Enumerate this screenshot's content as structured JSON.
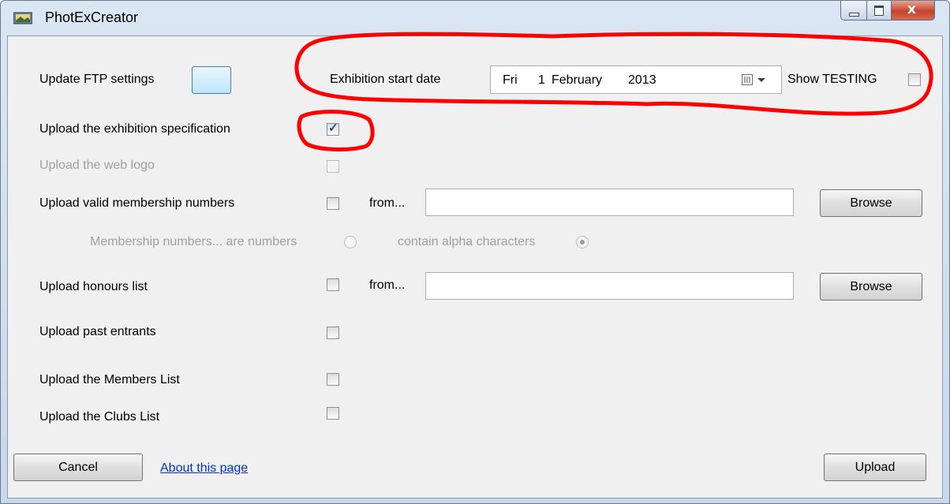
{
  "window": {
    "title": "PhotExCreator"
  },
  "ftp": {
    "label": "Update FTP settings",
    "button_label": ""
  },
  "exhibition": {
    "label": "Exhibition start date",
    "weekday": "Fri",
    "day": "1",
    "month": "February",
    "year": "2013"
  },
  "testing": {
    "label": "Show TESTING",
    "checked": false
  },
  "options": {
    "spec": {
      "label": "Upload the exhibition specification",
      "checked": true
    },
    "weblogo": {
      "label": "Upload the web logo",
      "checked": false,
      "disabled": true
    },
    "membership": {
      "label": "Upload valid membership numbers",
      "checked": false,
      "from_label": "from...",
      "path_value": "",
      "browse_label": "Browse"
    },
    "membership_type": {
      "label": "Membership numbers... are numbers",
      "alpha_label": "contain alpha characters",
      "selected": "contain alpha characters"
    },
    "honours": {
      "label": "Upload honours list",
      "checked": false,
      "from_label": "from...",
      "path_value": "",
      "browse_label": "Browse"
    },
    "past_entrants": {
      "label": "Upload past entrants",
      "checked": false
    },
    "members_list": {
      "label": "Upload the Members List",
      "checked": false
    },
    "clubs_list": {
      "label": "Upload the Clubs List",
      "checked": false
    }
  },
  "footer": {
    "cancel_label": "Cancel",
    "about_label": "About this page",
    "upload_label": "Upload"
  },
  "colors": {
    "annotation": "#ff0000",
    "link": "#0033cc"
  }
}
